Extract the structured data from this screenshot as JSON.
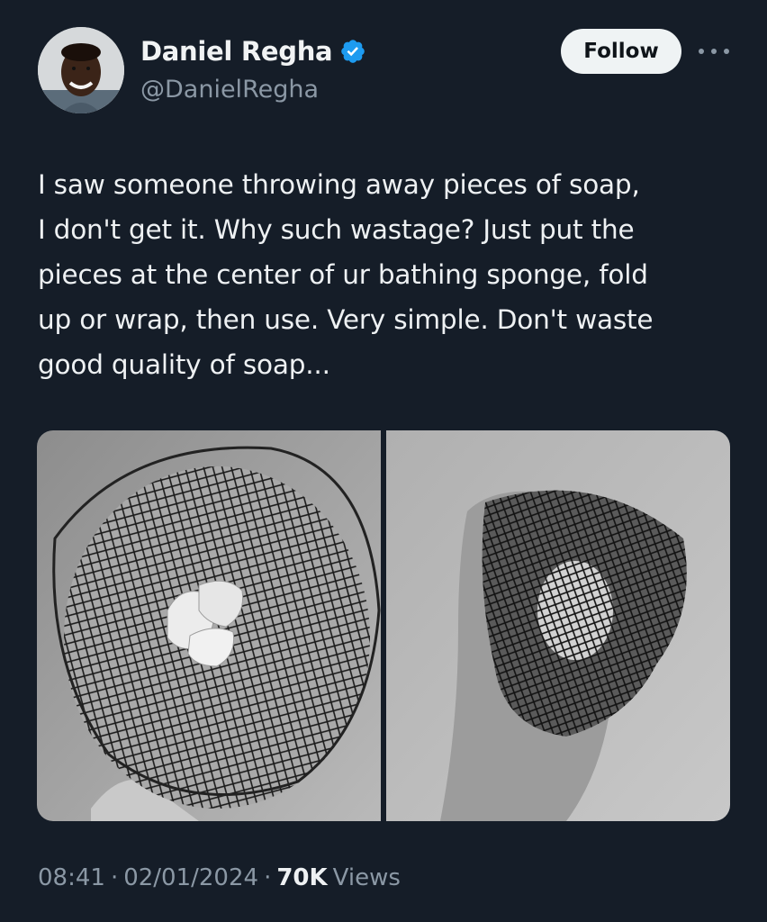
{
  "author": {
    "display_name": "Daniel Regha",
    "handle": "@DanielRegha",
    "verified": true,
    "avatar_icon": "profile-photo"
  },
  "actions": {
    "follow_label": "Follow",
    "more_icon": "more-horizontal-icon"
  },
  "tweet": {
    "text": "I saw someone throwing away pieces of soap,\nI don't get it. Why such wastage? Just put the\npieces at the center of ur bathing sponge, fold\nup or wrap, then use. Very simple. Don't waste\ngood quality of soap..."
  },
  "media": {
    "images": [
      {
        "subject": "soap pieces on net sponge"
      },
      {
        "subject": "hand holding wrapped net sponge"
      }
    ]
  },
  "meta": {
    "time": "08:41",
    "separator_1": "·",
    "date": "02/01/2024",
    "separator_2": "·",
    "views_count": "70K",
    "views_label": "Views"
  },
  "colors": {
    "background": "#151d28",
    "verified_blue": "#1d9bf0",
    "secondary_text": "#8b98a5"
  }
}
